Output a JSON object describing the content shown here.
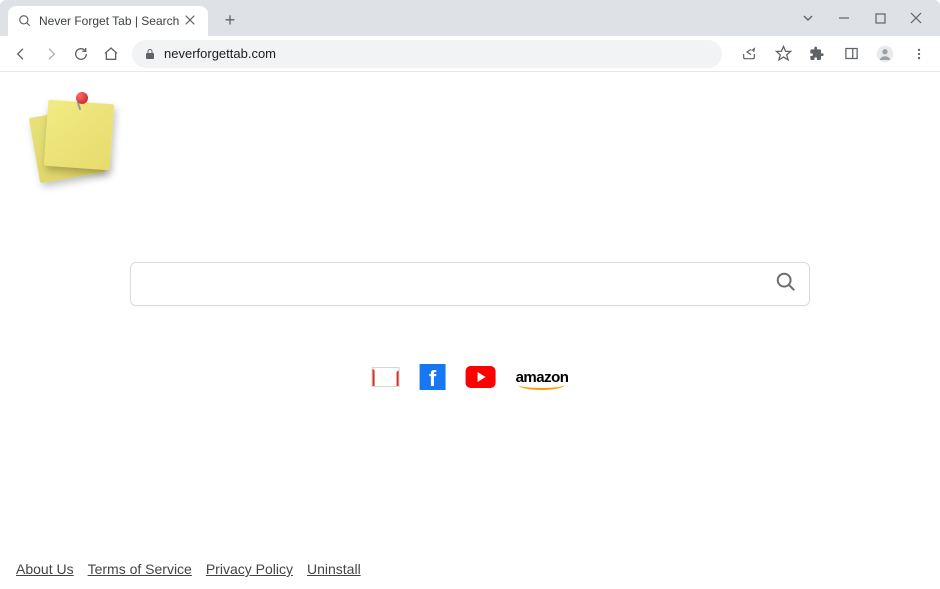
{
  "browser": {
    "tab_title": "Never Forget Tab | Search",
    "url": "neverforgettab.com"
  },
  "search": {
    "value": "",
    "placeholder": ""
  },
  "shortcuts": {
    "gmail": "Gmail",
    "facebook": "Facebook",
    "youtube": "YouTube",
    "amazon_text": "amazon"
  },
  "footer": {
    "about": "About Us",
    "terms": "Terms of Service",
    "privacy": "Privacy Policy",
    "uninstall": "Uninstall"
  }
}
